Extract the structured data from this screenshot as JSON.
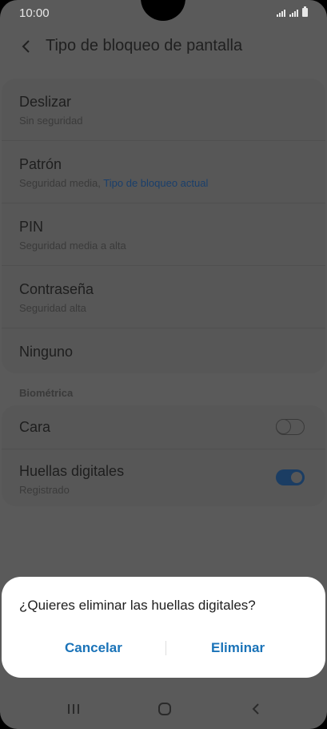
{
  "status_bar": {
    "time": "10:00"
  },
  "header": {
    "title": "Tipo de bloqueo de pantalla"
  },
  "lock_types": [
    {
      "title": "Deslizar",
      "subtitle": "Sin seguridad"
    },
    {
      "title": "Patrón",
      "subtitle": "Seguridad media,",
      "subtitle_accent": "Tipo de bloqueo actual"
    },
    {
      "title": "PIN",
      "subtitle": "Seguridad media a alta"
    },
    {
      "title": "Contraseña",
      "subtitle": "Seguridad alta"
    },
    {
      "title": "Ninguno"
    }
  ],
  "biometrics": {
    "section_label": "Biométrica",
    "items": [
      {
        "title": "Cara",
        "enabled": false
      },
      {
        "title": "Huellas digitales",
        "subtitle": "Registrado",
        "enabled": true
      }
    ]
  },
  "dialog": {
    "message": "¿Quieres eliminar las huellas digitales?",
    "cancel_label": "Cancelar",
    "confirm_label": "Eliminar"
  },
  "colors": {
    "accent": "#1a73b8",
    "scrim_background": "#5a5a5a",
    "dialog_background": "#ffffff"
  },
  "icons": {
    "back": "chevron-left-icon",
    "nav_recents": "recents-icon",
    "nav_home": "home-icon",
    "nav_back": "nav-back-icon"
  }
}
